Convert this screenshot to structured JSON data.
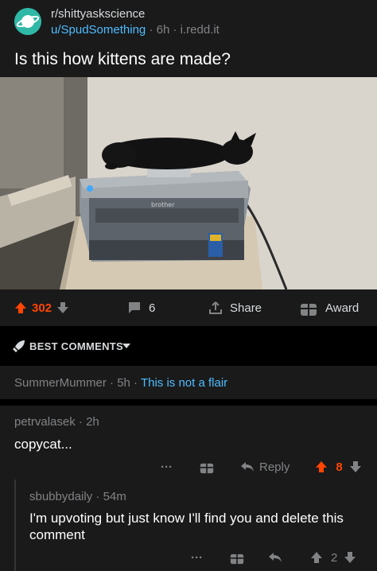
{
  "post": {
    "subreddit": "r/shittyaskscience",
    "author": "u/SpudSomething",
    "age": "6h",
    "domain": "i.redd.it",
    "separator": "·",
    "title": "Is this how kittens are made?",
    "image_label": "brother"
  },
  "actions": {
    "score": "302",
    "comments": "6",
    "share": "Share",
    "award": "Award"
  },
  "sort": {
    "label": "BEST COMMENTS"
  },
  "flair_comment": {
    "author": "SummerMummer",
    "age": "5h",
    "flair": "This is not a flair"
  },
  "comments": [
    {
      "author": "petrvalasek",
      "age": "2h",
      "body": "copycat...",
      "more": "···",
      "reply": "Reply",
      "score": "8"
    },
    {
      "author": "sbubbydaily",
      "age": "54m",
      "body": "I'm upvoting but just know I'll find you and delete this comment",
      "more": "···",
      "score": "2"
    }
  ],
  "colors": {
    "background": "#000000",
    "card": "#1a1a1b",
    "upvote": "#ff4500",
    "link": "#4fbcff",
    "muted": "#818384"
  },
  "icons": [
    "subreddit-avatar-icon",
    "upvote-icon",
    "downvote-icon",
    "comment-icon",
    "share-icon",
    "award-icon",
    "rocket-icon",
    "chevron-down-icon",
    "more-icon",
    "gift-icon",
    "reply-icon"
  ]
}
